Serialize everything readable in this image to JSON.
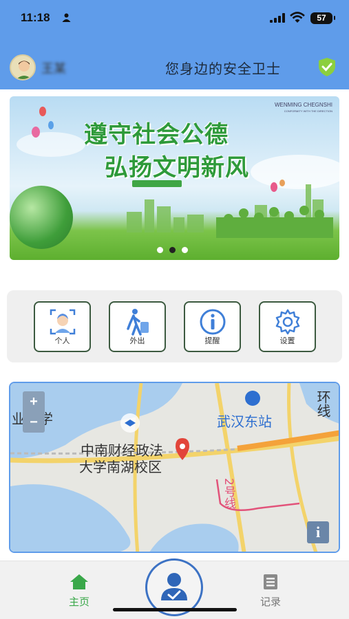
{
  "status_bar": {
    "time": "11:18",
    "battery": "57"
  },
  "header": {
    "username": "王某",
    "slogan": "您身边的安全卫士"
  },
  "banner": {
    "line1": "遵守社会公德",
    "line2": "弘扬文明新风",
    "english_title": "WENMING CHEGNSHI",
    "english_subtitle": "CONFORMITY WITH THE DIRECTION",
    "active_slide": 2,
    "slide_count": 3
  },
  "quick_actions": [
    {
      "label": "个人",
      "icon": "face-scan-icon"
    },
    {
      "label": "外出",
      "icon": "walking-person-icon"
    },
    {
      "label": "提醒",
      "icon": "info-icon"
    },
    {
      "label": "设置",
      "icon": "gear-icon"
    }
  ],
  "map": {
    "labels": {
      "university_left": "业大学",
      "station": "武汉东站",
      "ring": "环线",
      "campus_line1": "中南财经政法",
      "campus_line2": "大学南湖校区",
      "line2": "2号线"
    },
    "zoom_in": "+",
    "zoom_out": "−",
    "info": "i"
  },
  "bottom_nav": {
    "home": "主页",
    "records": "记录"
  },
  "colors": {
    "header_blue": "#5f9cea",
    "accent_green": "#3aa84a",
    "button_border": "#3c5a40"
  }
}
